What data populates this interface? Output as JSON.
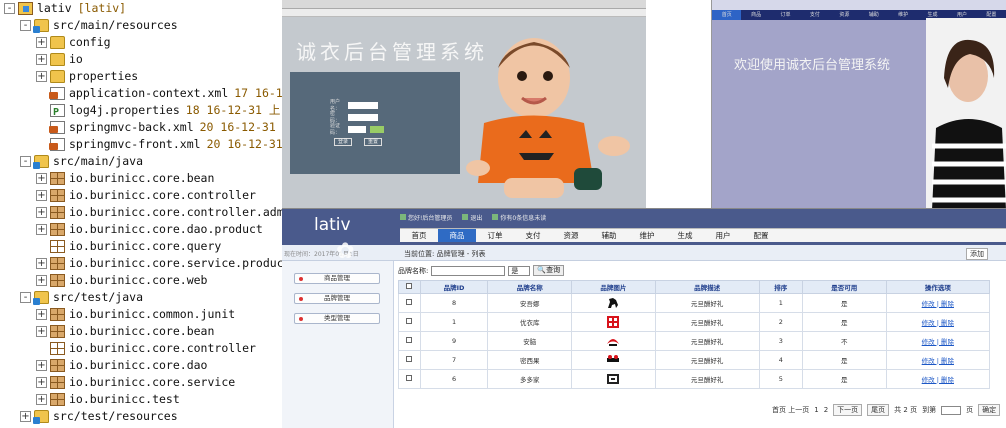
{
  "tree": {
    "items": [
      {
        "label": "lativ",
        "decoration": "[lativ]",
        "exp": "-",
        "icon": "project-icon",
        "indent": 0
      },
      {
        "label": "src/main/resources",
        "decoration": "",
        "exp": "-",
        "icon": "folder-icon",
        "indent": 1
      },
      {
        "label": "config",
        "decoration": "",
        "exp": "+",
        "icon": "folder-icon",
        "indent": 2
      },
      {
        "label": "io",
        "decoration": "",
        "exp": "+",
        "icon": "folder-icon",
        "indent": 2
      },
      {
        "label": "properties",
        "decoration": "",
        "exp": "+",
        "icon": "folder-icon",
        "indent": 2
      },
      {
        "label": "application-context.xml",
        "decoration": "17  16-1",
        "exp": "",
        "icon": "xml-file-icon",
        "indent": 2
      },
      {
        "label": "log4j.properties",
        "decoration": "18  16-12-31 上",
        "exp": "",
        "icon": "properties-file-icon",
        "indent": 2
      },
      {
        "label": "springmvc-back.xml",
        "decoration": "20  16-12-31",
        "exp": "",
        "icon": "xml-file-icon",
        "indent": 2
      },
      {
        "label": "springmvc-front.xml",
        "decoration": "20  16-12-31",
        "exp": "",
        "icon": "xml-file-icon",
        "indent": 2
      },
      {
        "label": "src/main/java",
        "decoration": "",
        "exp": "-",
        "icon": "folder-icon",
        "indent": 1
      },
      {
        "label": "io.burinicc.core.bean",
        "decoration": "",
        "exp": "+",
        "icon": "package-icon",
        "indent": 2
      },
      {
        "label": "io.burinicc.core.controller",
        "decoration": "",
        "exp": "+",
        "icon": "package-icon",
        "indent": 2
      },
      {
        "label": "io.burinicc.core.controller.admin",
        "decoration": "",
        "exp": "+",
        "icon": "package-icon",
        "indent": 2
      },
      {
        "label": "io.burinicc.core.dao.product",
        "decoration": "",
        "exp": "+",
        "icon": "package-icon",
        "indent": 2
      },
      {
        "label": "io.burinicc.core.query",
        "decoration": "",
        "exp": "",
        "icon": "empty-package-icon",
        "indent": 2
      },
      {
        "label": "io.burinicc.core.service.product",
        "decoration": "",
        "exp": "+",
        "icon": "package-icon",
        "indent": 2
      },
      {
        "label": "io.burinicc.core.web",
        "decoration": "",
        "exp": "+",
        "icon": "package-icon",
        "indent": 2
      },
      {
        "label": "src/test/java",
        "decoration": "",
        "exp": "-",
        "icon": "folder-icon",
        "indent": 1
      },
      {
        "label": "io.burinicc.common.junit",
        "decoration": "",
        "exp": "+",
        "icon": "package-icon",
        "indent": 2
      },
      {
        "label": "io.burinicc.core.bean",
        "decoration": "",
        "exp": "+",
        "icon": "package-icon",
        "indent": 2
      },
      {
        "label": "io.burinicc.core.controller",
        "decoration": "",
        "exp": "",
        "icon": "empty-package-icon",
        "indent": 2
      },
      {
        "label": "io.burinicc.core.dao",
        "decoration": "",
        "exp": "+",
        "icon": "package-icon",
        "indent": 2
      },
      {
        "label": "io.burinicc.core.service",
        "decoration": "",
        "exp": "+",
        "icon": "package-icon",
        "indent": 2
      },
      {
        "label": "io.burinicc.test",
        "decoration": "",
        "exp": "+",
        "icon": "package-icon",
        "indent": 2
      },
      {
        "label": "src/test/resources",
        "decoration": "",
        "exp": "+",
        "icon": "folder-icon",
        "indent": 1
      }
    ]
  },
  "login": {
    "title": "诚衣后台管理系统",
    "username_label": "用户名：",
    "password_label": "密码：",
    "captcha_label": "验证码：",
    "login_button": "登录",
    "reset_button": "重置"
  },
  "welcome": {
    "nav": [
      "首页",
      "商品",
      "订单",
      "支付",
      "资源",
      "辅助",
      "维护",
      "生成",
      "用户",
      "配置"
    ],
    "text": "欢迎使用诚衣后台管理系统"
  },
  "admin": {
    "logo": "lativ",
    "header_links": [
      "您好!后台管理员",
      "退出",
      "你有0条信息未读"
    ],
    "nav": [
      "首页",
      "商品",
      "订单",
      "支付",
      "资源",
      "辅助",
      "维护",
      "生成",
      "用户",
      "配置"
    ],
    "active_nav": "商品",
    "time": "现在时间：2017年01月1日",
    "breadcrumb": "当前位置: 品牌管理 - 列表",
    "add_button": "添加",
    "sidebar": [
      "商品管理",
      "品牌管理",
      "类型管理"
    ],
    "filter": {
      "label": "品牌名称:",
      "select": "是",
      "query_button": "查询"
    },
    "table": {
      "headers": [
        "品牌ID",
        "品牌名称",
        "品牌图片",
        "品牌描述",
        "排序",
        "是否可用",
        "操作选项"
      ],
      "rows": [
        {
          "id": "8",
          "name": "安吾娜",
          "desc": "元旦酬好礼",
          "sort": "1",
          "avail": "是",
          "ops": "修改 | 删除"
        },
        {
          "id": "1",
          "name": "优衣库",
          "desc": "元旦酬好礼",
          "sort": "2",
          "avail": "是",
          "ops": "修改 | 删除"
        },
        {
          "id": "9",
          "name": "安脑",
          "desc": "元旦酬好礼",
          "sort": "3",
          "avail": "不",
          "ops": "修改 | 删除"
        },
        {
          "id": "7",
          "name": "密西果",
          "desc": "元旦酬好礼",
          "sort": "4",
          "avail": "是",
          "ops": "修改 | 删除"
        },
        {
          "id": "6",
          "name": "多多家",
          "desc": "元旦酬好礼",
          "sort": "5",
          "avail": "是",
          "ops": "修改 | 删除"
        }
      ]
    },
    "pager": {
      "first_prev": "首页 上一页",
      "pages": "1",
      "page2": "2",
      "next": "下一页",
      "last": "尾页",
      "total": "共 2 页",
      "goto": "到第",
      "page_unit": "页",
      "confirm": "确定"
    }
  },
  "colors": {
    "header_blue": "#4a5a8c",
    "nav_active": "#2f6bc4",
    "link_blue": "#1c57c6",
    "login_panel": "#56697a"
  }
}
